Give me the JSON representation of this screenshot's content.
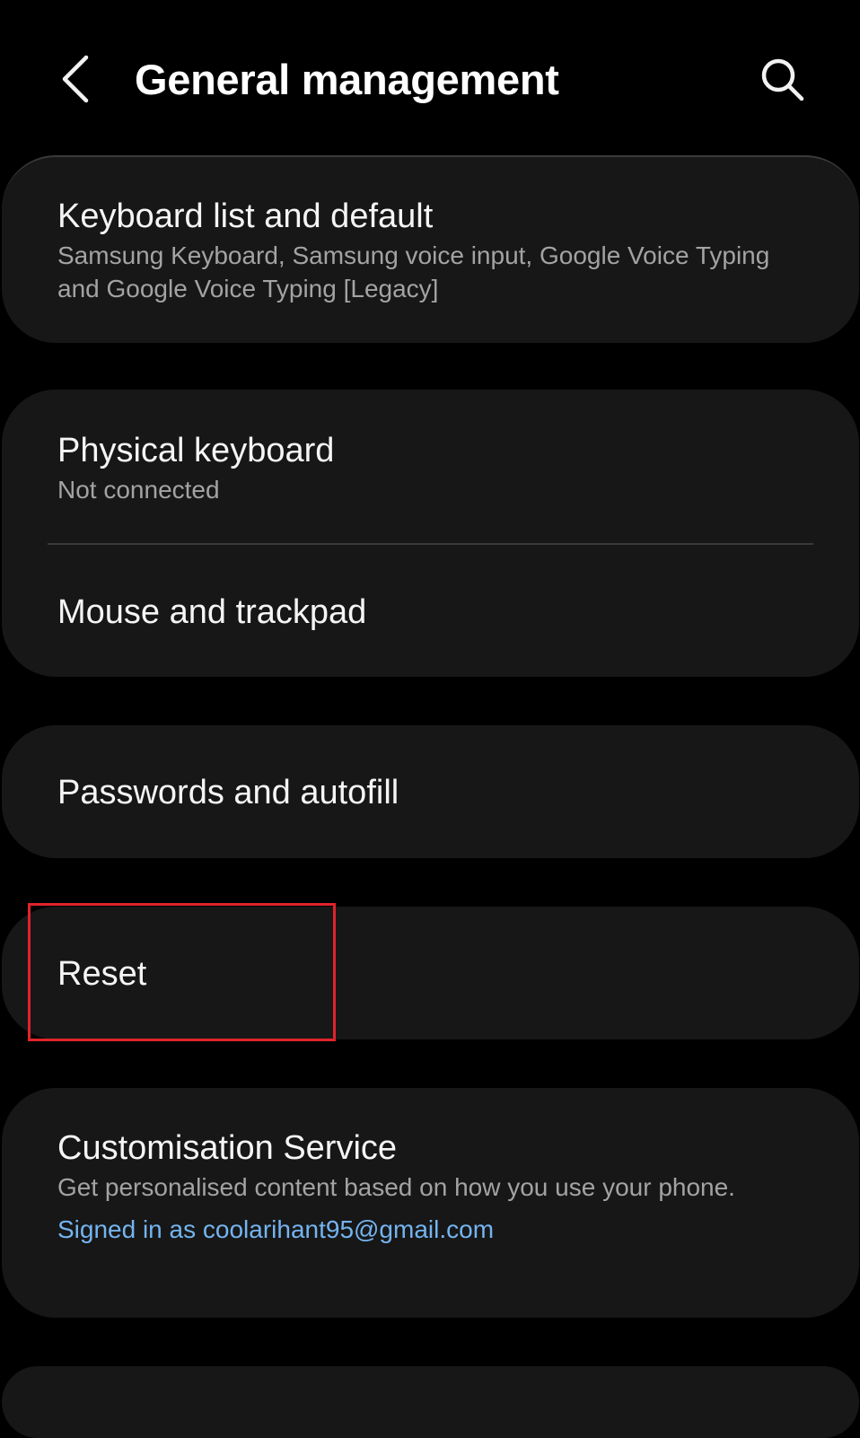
{
  "header": {
    "title": "General management",
    "back_icon": "chevron-left-icon",
    "search_icon": "search-icon"
  },
  "items": [
    {
      "title": "Keyboard list and default",
      "subtitle": "Samsung Keyboard, Samsung voice input, Google Voice Typing and Google Voice Typing [Legacy]"
    },
    {
      "title": "Physical keyboard",
      "subtitle": "Not connected"
    },
    {
      "title": "Mouse and trackpad"
    },
    {
      "title": "Passwords and autofill"
    },
    {
      "title": "Reset"
    },
    {
      "title": "Customisation Service",
      "subtitle": "Get personalised content based on how you use your phone.",
      "link": "Signed in as coolarihant95@gmail.com"
    }
  ],
  "colors": {
    "background": "#000000",
    "card": "#171717",
    "title_text": "#f5f5f5",
    "subtitle_text": "#a3a3a3",
    "link_text": "#74b4f0",
    "highlight": "#e0242c"
  }
}
